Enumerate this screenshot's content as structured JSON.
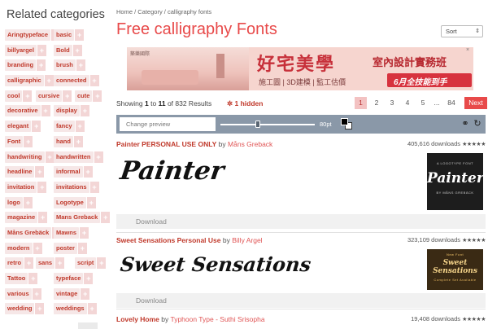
{
  "sidebar": {
    "title": "Related categories",
    "rows": [
      [
        "Aringtypeface",
        "basic"
      ],
      [
        "billyargel",
        "Bold"
      ],
      [
        "branding",
        "brush"
      ],
      [
        "calligraphic",
        "connected"
      ],
      [
        "cool",
        "cursive",
        "cute"
      ],
      [
        "decorative",
        "display"
      ],
      [
        "elegant",
        "fancy"
      ],
      [
        "Font",
        "hand"
      ],
      [
        "handwriting",
        "handwritten"
      ],
      [
        "headline",
        "informal"
      ],
      [
        "invitation",
        "invitations"
      ],
      [
        "logo",
        "Logotype"
      ],
      [
        "magazine",
        "Mans Greback"
      ],
      [
        "Måns Grebäck",
        "Mawns"
      ],
      [
        "modern",
        "poster"
      ],
      [
        "retro",
        "sans",
        "script"
      ],
      [
        "Tattoo",
        "typeface"
      ],
      [
        "various",
        "vintage"
      ],
      [
        "wedding",
        "weddings"
      ]
    ]
  },
  "breadcrumb": "Home / Category / calligraphy fonts",
  "page_title": "Free calligraphy Fonts",
  "sort_label": "Sort",
  "ad": {
    "brand": "築樂國際",
    "headline": "好宅美學",
    "headline2": "室內設計實務班",
    "sub": "施工圖 | 3D建模 | 監工估價",
    "badge": "6月全技能到手"
  },
  "results": {
    "showing": "Showing",
    "from": "1",
    "to_word": "to",
    "to": "11",
    "of_text": "of 832 Results",
    "hidden": "1 hidden"
  },
  "pagination": {
    "pages": [
      "1",
      "2",
      "3",
      "4",
      "5",
      "...",
      "84"
    ],
    "next": "Next"
  },
  "toolbar": {
    "preview_placeholder": "Change preview",
    "size": "80pt",
    "size_level": 0.4
  },
  "fonts": [
    {
      "name": "Painter PERSONAL USE ONLY",
      "by": "by",
      "author": "Måns Greback",
      "downloads": "405,616 downloads",
      "preview": "Painter",
      "thumb_top": "A LOGOTYPE FONT",
      "thumb_main": "Painter",
      "thumb_bottom": "BY MÅNS GREBÄCK",
      "download_label": "Download"
    },
    {
      "name": "Sweet Sensations Personal Use",
      "by": "by",
      "author": "Billy Argel",
      "downloads": "323,109 downloads",
      "preview": "Sweet Sensations",
      "thumb_top": "New Font",
      "thumb_main": "Sweet Sensations",
      "thumb_bottom": "Complete Set Available",
      "download_label": "Download"
    },
    {
      "name": "Lovely Home",
      "by": "by",
      "author": "Typhoon Type - Suthi Srisopha",
      "downloads": "19,408 downloads"
    }
  ],
  "stars": "★★★★★",
  "colors": {
    "accent": "#e84a4a",
    "link": "#c0392b",
    "toolbar": "#8a98a8"
  }
}
